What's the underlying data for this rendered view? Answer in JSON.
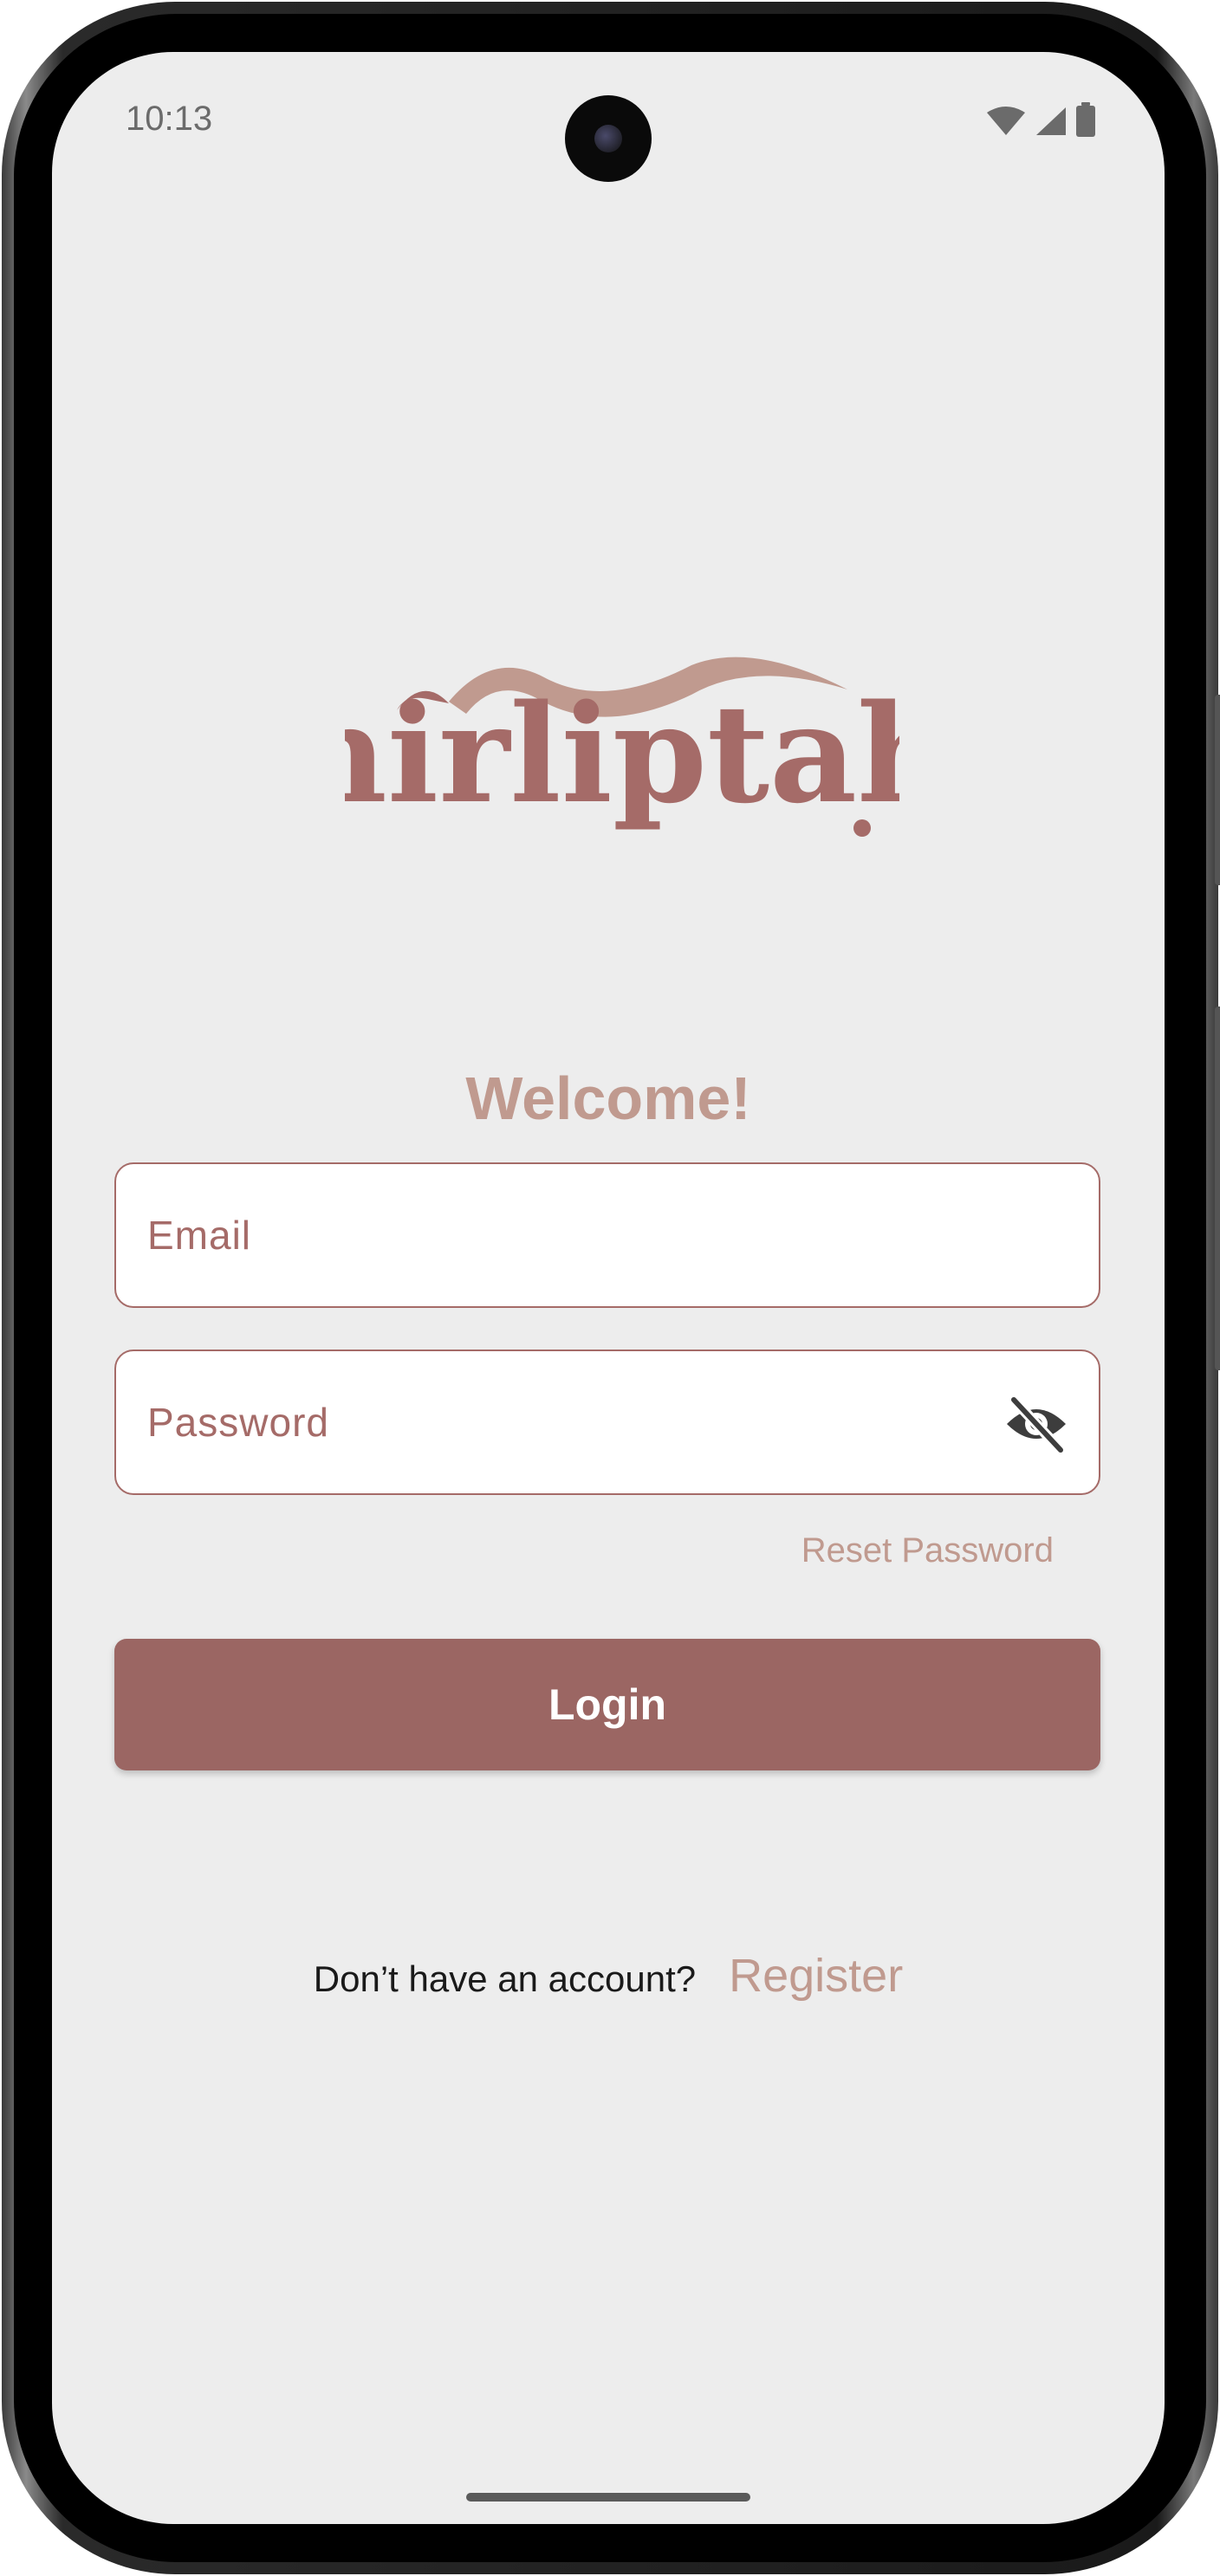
{
  "status_bar": {
    "time": "10:13",
    "icons": [
      "wifi-icon",
      "cellular-signal-icon",
      "battery-icon"
    ]
  },
  "logo": {
    "text": "nirliptah",
    "colors": {
      "text": "#a56b68",
      "swoosh": "#c09a8f"
    }
  },
  "welcome": "Welcome!",
  "form": {
    "email": {
      "placeholder": "Email",
      "value": ""
    },
    "password": {
      "placeholder": "Password",
      "value": "",
      "toggle_icon": "eye-off-icon"
    },
    "reset_password": "Reset Password",
    "login_label": "Login"
  },
  "register": {
    "prompt": "Don’t have an account?",
    "link": "Register"
  },
  "colors": {
    "background": "#ededed",
    "accent": "#9b6663",
    "accent_light": "#c09a8f",
    "field_border": "#a56b68"
  }
}
